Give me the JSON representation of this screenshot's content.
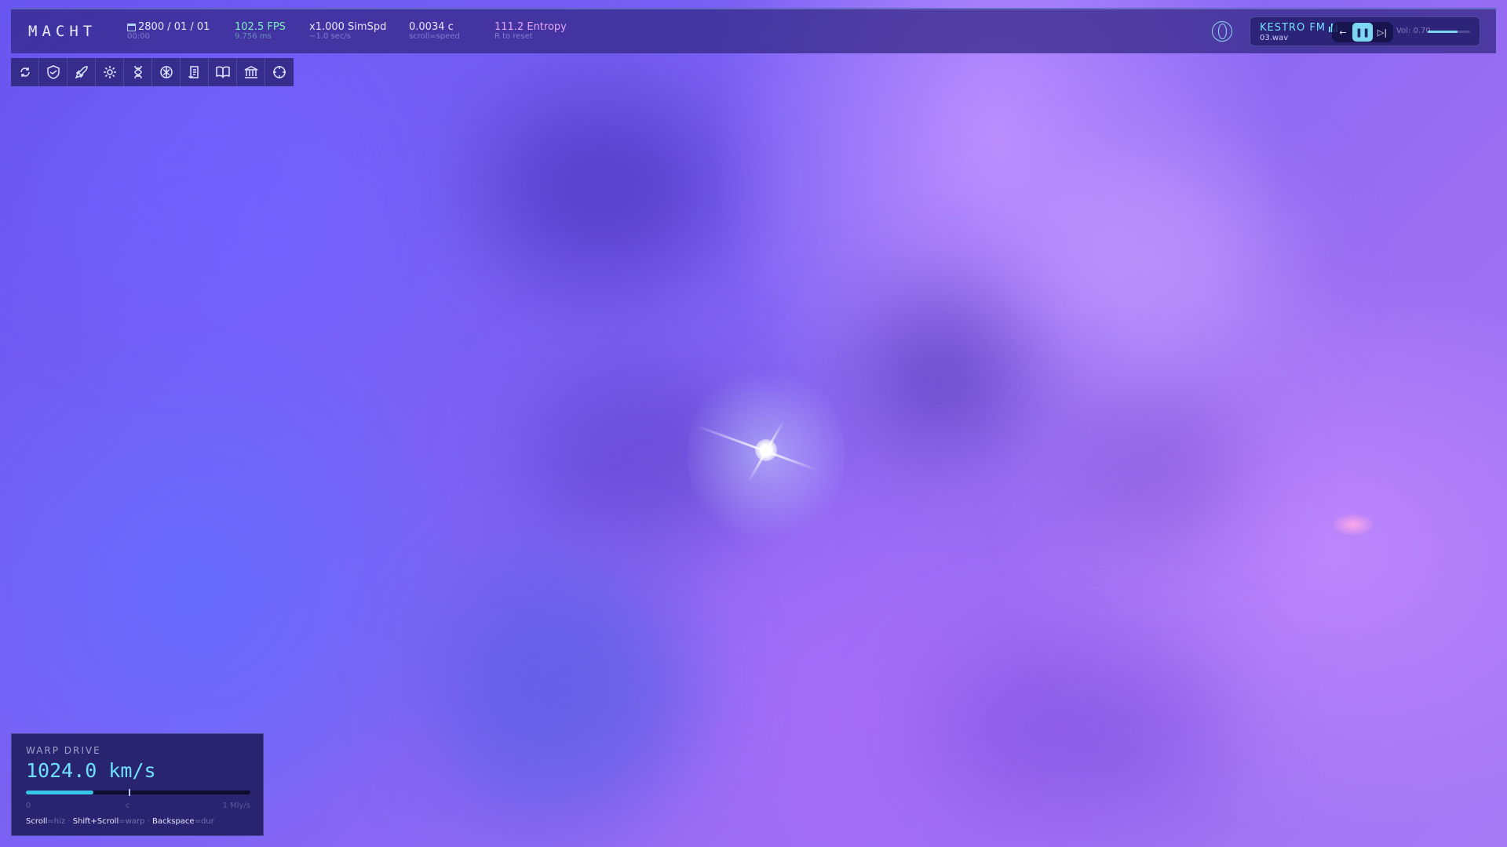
{
  "app": {
    "title": "MACHT"
  },
  "stats": {
    "date": {
      "value": "2800 / 01 / 01",
      "sub": "00:00",
      "icon": "calendar-icon"
    },
    "fps": {
      "value": "102.5 FPS",
      "sub": "9.756 ms"
    },
    "sim_speed": {
      "value": "x1.000 SimSpd",
      "sub": "~1.0 sec/s"
    },
    "velocity": {
      "value": "0.0034 c",
      "sub": "scroll=speed"
    },
    "entropy": {
      "value": "111.2 Entropy",
      "sub": "R to reset"
    }
  },
  "radio": {
    "station": "KESTRO FM",
    "track": "03.wav",
    "volume_label": "Vol: 0.70",
    "volume": 0.7,
    "controls": {
      "prev": "prev-icon",
      "play_pause": "pause-icon",
      "next": "skip-next-icon"
    }
  },
  "toolbar": [
    {
      "icon": "orbit-refresh-icon"
    },
    {
      "icon": "handshake-shield-icon"
    },
    {
      "icon": "ship-icon"
    },
    {
      "icon": "gear-icon"
    },
    {
      "icon": "dna-icon"
    },
    {
      "icon": "brain-icon"
    },
    {
      "icon": "scroll-icon"
    },
    {
      "icon": "book-icon"
    },
    {
      "icon": "government-building-icon"
    },
    {
      "icon": "crosshair-icon"
    }
  ],
  "warp": {
    "title": "WARP DRIVE",
    "speed": "1024.0 km/s",
    "bar_fraction": 0.3,
    "scale_min": "0",
    "scale_mid": "c",
    "scale_max": "1 Mly/s",
    "help": [
      {
        "key": "Scroll",
        "desc": "=hiz"
      },
      {
        "key": "Shift+Scroll",
        "desc": "=warp"
      },
      {
        "key": "Backspace",
        "desc": "=dur"
      }
    ]
  },
  "colors": {
    "accent": "#6fe3ff",
    "fps": "#7ff0c2",
    "entropy": "#e3a4ff",
    "hud_bg": "#302682"
  }
}
